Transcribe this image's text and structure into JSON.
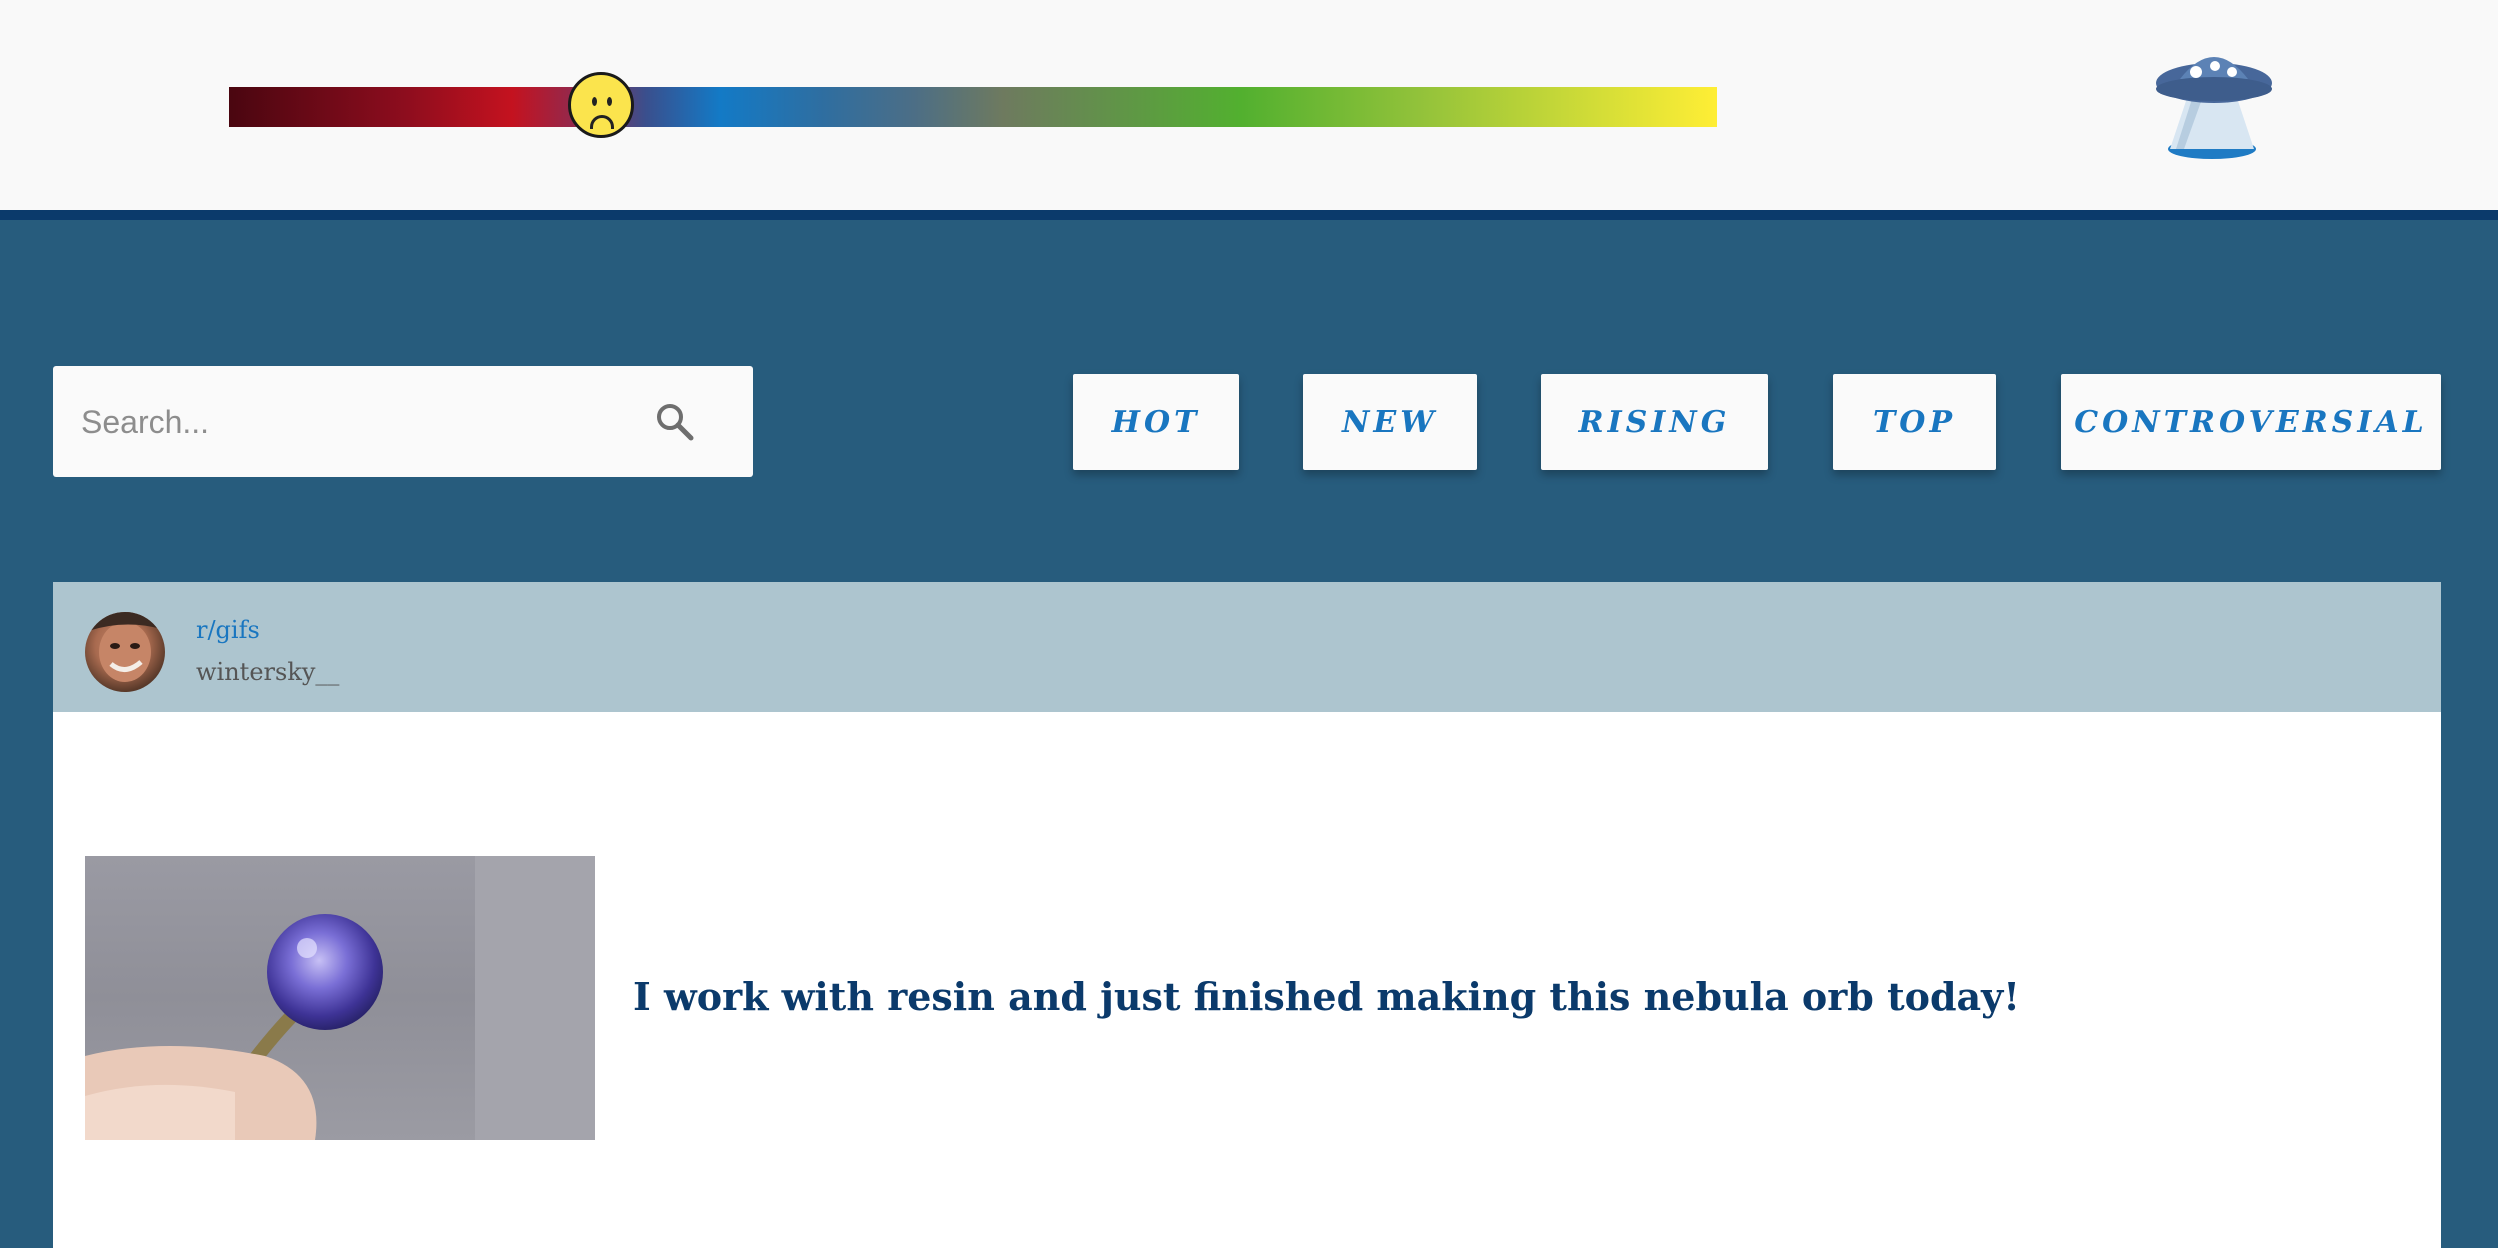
{
  "header": {
    "mood_slider": {
      "value": 0.25,
      "face": "sad"
    },
    "logo_icon": "ufo-icon"
  },
  "search": {
    "placeholder": "Search...",
    "icon": "search-icon"
  },
  "sort_tabs": [
    {
      "label": "HOT"
    },
    {
      "label": "NEW"
    },
    {
      "label": "RISING"
    },
    {
      "label": "TOP"
    },
    {
      "label": "CONTROVERSIAL"
    }
  ],
  "post": {
    "subreddit": "r/gifs",
    "author": "wintersky__",
    "title": "I work with resin and just finished making this nebula orb today!",
    "thumbnail_icon": "nebula-orb-thumbnail"
  },
  "colors": {
    "page_background": "#275c7d",
    "header_background": "#f9f9f9",
    "header_border": "#0b3a6b",
    "accent": "#1976c0",
    "post_header_background": "#adc5cf",
    "title_color": "#0b3a6b"
  }
}
